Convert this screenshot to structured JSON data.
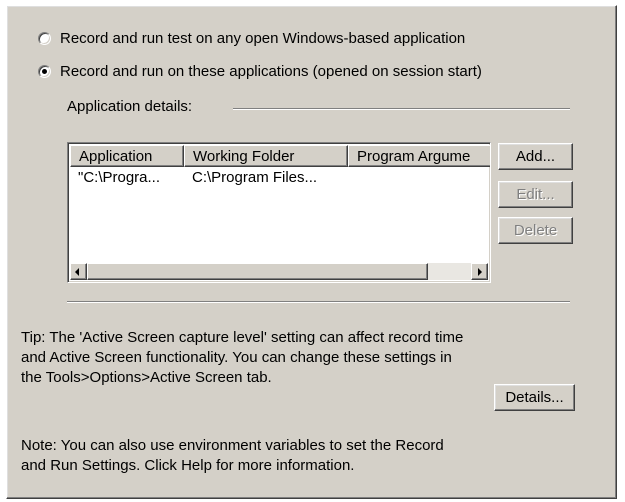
{
  "record_mode": {
    "options": [
      {
        "label": "Record and run test on any open Windows-based application",
        "checked": false
      },
      {
        "label": "Record and run on these applications (opened on session start)",
        "checked": true
      }
    ]
  },
  "app_details": {
    "group_label": "Application details:",
    "columns": [
      "Application",
      "Working Folder",
      "Program Argume"
    ],
    "rows": [
      {
        "application": "\"C:\\Progra...",
        "working_folder": "C:\\Program Files...",
        "program_arguments": ""
      }
    ],
    "buttons": {
      "add": "Add...",
      "edit": "Edit...",
      "delete": "Delete"
    },
    "button_enabled": {
      "add": true,
      "edit": false,
      "delete": false
    }
  },
  "tip": {
    "line1": "Tip: The 'Active Screen capture level' setting can affect record time",
    "line2": "and Active Screen functionality.  You can change these settings in",
    "line3": "the Tools>Options>Active Screen tab.",
    "details_button": "Details..."
  },
  "note": {
    "line1": "Note: You can also use environment variables to set the Record",
    "line2": "and Run Settings.  Click Help for more information."
  },
  "colors": {
    "dialog_bg": "#d4d0c8",
    "list_bg": "#ffffff",
    "disabled_text": "#808080"
  }
}
